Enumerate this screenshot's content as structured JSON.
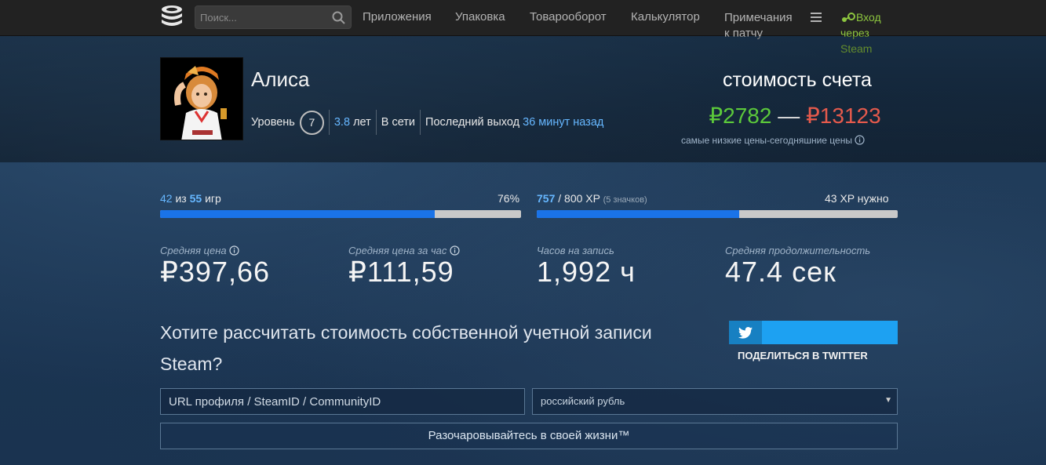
{
  "nav": {
    "search_placeholder": "Поиск...",
    "apps": "Приложения",
    "packages": "Упаковка",
    "trade": "Товарооборот",
    "calculator": "Калькулятор",
    "patch_notes": "Примечания к патчу",
    "login": "Вход через Steam"
  },
  "profile": {
    "name": "Алиса",
    "level_label": "Уровень",
    "level": "7",
    "years_value": "3.8",
    "years_label": "лет",
    "status": "В сети",
    "last_logout_label": "Последний выход",
    "last_logout_value": "36 минут назад"
  },
  "valuation": {
    "title": "стоимость счета",
    "low": "₽2782",
    "dash": "—",
    "high": "₽13123",
    "note": "самые низкие цены-сегодняшние цены"
  },
  "games_progress": {
    "played": "42",
    "of": "из",
    "total": "55",
    "unit": "игр",
    "percent_label": "76%",
    "percent": 0.76
  },
  "xp_progress": {
    "current": "757",
    "max_label": "/ 800 XP",
    "badges": "(5 значков)",
    "needed": "43 XP нужно",
    "fraction": 0.56
  },
  "stats": [
    {
      "label": "Средняя цена",
      "value": "₽397,66"
    },
    {
      "label": "Средняя цена за час",
      "value": "₽111,59"
    },
    {
      "label": "Часов на запись",
      "value": "1,992 ч"
    },
    {
      "label": "Средняя продолжительность",
      "value": "47.4 сек"
    }
  ],
  "calc": {
    "question": "Хотите рассчитать стоимость собственной учетной записи Steam?",
    "share_label": "ПОДЕЛИТЬСЯ В TWITTER",
    "url_placeholder": "URL профиля / SteamID / CommunityID",
    "currency": "российский рубль",
    "submit": "Разочаровывайтесь в своей жизни™"
  },
  "colors": {
    "accent_blue": "#1a73e8",
    "link_blue": "#66b7ff",
    "low_green": "#5cc93b",
    "high_red": "#e55a4c",
    "steam_green": "#8dc63f",
    "twitter": "#1da1f2"
  }
}
